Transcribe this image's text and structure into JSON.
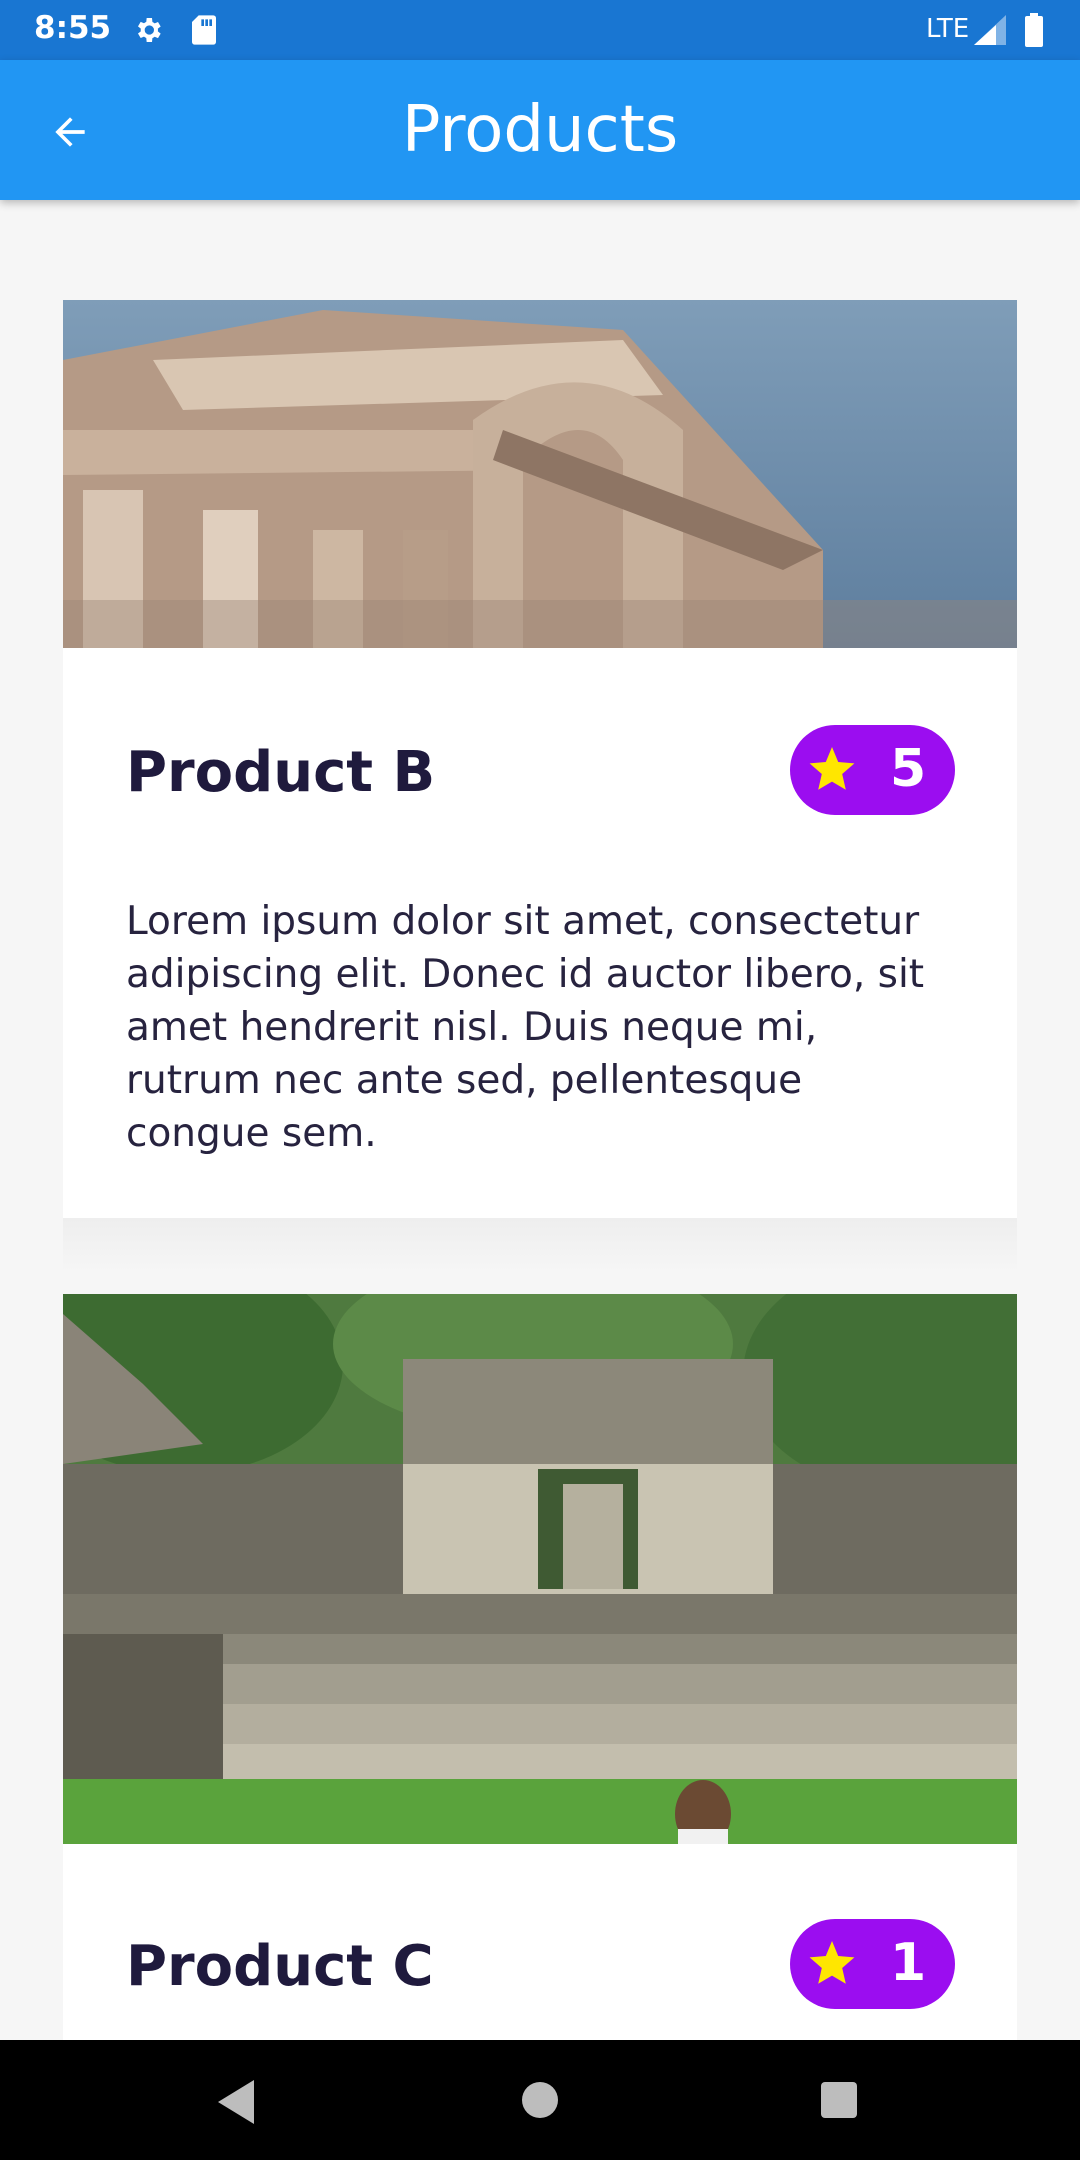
{
  "status_bar": {
    "time": "8:55",
    "network": "LTE",
    "icons": [
      "gear-icon",
      "sd-card-icon",
      "signal-icon",
      "battery-icon"
    ]
  },
  "app_bar": {
    "title": "Products",
    "back_icon": "arrow-back-icon",
    "color": "#2196f3"
  },
  "products": [
    {
      "name": "Product B",
      "rating": "5",
      "description": "Lorem ipsum dolor sit amet, consectetur adipiscing elit. Donec id auctor libero, sit amet hendrerit nisl. Duis neque mi, rutrum nec ante sed, pellentesque congue sem.",
      "image_alt": "ancient stone temple ruins with arch"
    },
    {
      "name": "Product C",
      "rating": "1",
      "description": "",
      "image_alt": "stone ruins with steps on grassy field"
    }
  ],
  "colors": {
    "badge": "#9b0df0",
    "star": "#ffe600",
    "title_text": "#1f1a3d"
  },
  "nav_bar": {
    "icons": [
      "nav-back-icon",
      "nav-home-icon",
      "nav-recents-icon"
    ]
  }
}
